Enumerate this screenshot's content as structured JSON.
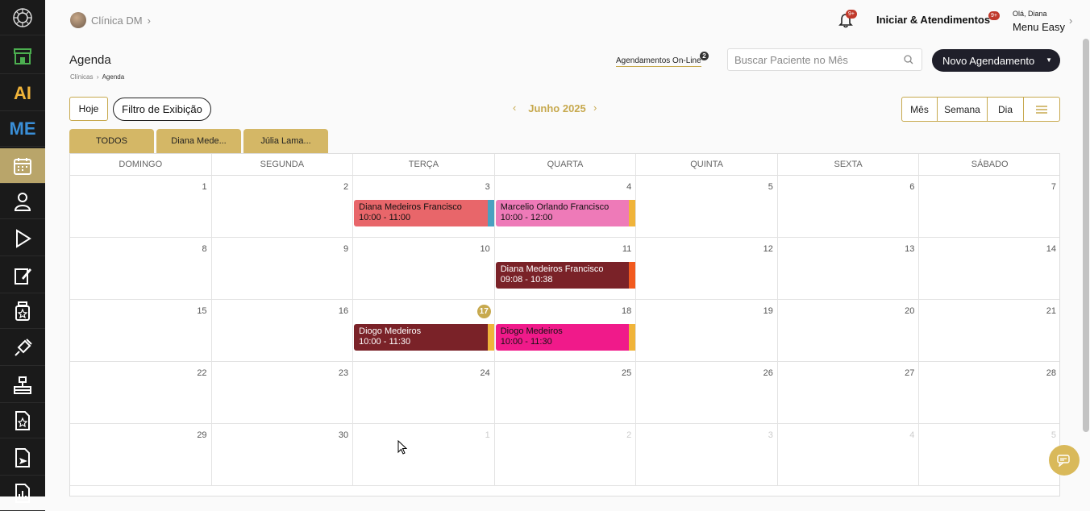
{
  "colors": {
    "accent": "#c7a94e",
    "tab_bg": "#d4b766",
    "sidebar": "#1a1a1a",
    "primary_button": "#1f1f2a"
  },
  "sidebar": {
    "items": [
      {
        "icon": "logo-icon"
      },
      {
        "icon": "store-icon"
      },
      {
        "icon": "ai-icon",
        "text": "AI"
      },
      {
        "icon": "me-icon",
        "text": "ME"
      },
      {
        "icon": "calendar-icon"
      },
      {
        "icon": "doctor-icon"
      },
      {
        "icon": "play-icon"
      },
      {
        "icon": "edit-document-icon"
      },
      {
        "icon": "medicine-bottle-icon"
      },
      {
        "icon": "syringe-icon"
      },
      {
        "icon": "organization-icon"
      },
      {
        "icon": "star-document-icon"
      },
      {
        "icon": "send-document-icon"
      },
      {
        "icon": "chart-document-icon"
      }
    ]
  },
  "header": {
    "clinic": "Clínica DM",
    "notifications_badge": "9+",
    "iniciar_label": "Iniciar & Atendimentos",
    "iniciar_badge": "9+",
    "greeting": "Olá, Diana",
    "menu": "Menu Easy"
  },
  "page": {
    "title": "Agenda",
    "breadcrumb": [
      "Clínicas",
      "Agenda"
    ],
    "online_label": "Agendamentos On-Line",
    "online_count": "2",
    "search_placeholder": "Buscar Paciente no Mês",
    "new_button": "Novo Agendamento"
  },
  "toolbar": {
    "today": "Hoje",
    "filter": "Filtro de Exibição",
    "month": "Junho 2025",
    "views": [
      "Mês",
      "Semana",
      "Dia"
    ]
  },
  "tabs": [
    "TODOS",
    "Diana Mede...",
    "Júlia Lama..."
  ],
  "calendar": {
    "weekdays": [
      "DOMINGO",
      "SEGUNDA",
      "TERÇA",
      "QUARTA",
      "QUINTA",
      "SEXTA",
      "SÁBADO"
    ],
    "weeks": [
      [
        "1",
        "2",
        "3",
        "4",
        "5",
        "6",
        "7"
      ],
      [
        "8",
        "9",
        "10",
        "11",
        "12",
        "13",
        "14"
      ],
      [
        "15",
        "16",
        "17",
        "18",
        "19",
        "20",
        "21"
      ],
      [
        "22",
        "23",
        "24",
        "25",
        "26",
        "27",
        "28"
      ],
      [
        "29",
        "30",
        "1",
        "2",
        "3",
        "4",
        "5"
      ]
    ],
    "today": "17",
    "events": [
      {
        "week": 0,
        "day": 2,
        "name": "Diana Medeiros Francisco",
        "time": "10:00 - 11:00",
        "color": "#e8666a",
        "strip": "#4aa0c0",
        "text": "#111"
      },
      {
        "week": 0,
        "day": 3,
        "name": "Marcelio Orlando Francisco",
        "time": "10:00 - 12:00",
        "color": "#ee7ab8",
        "strip": "#f0b43a",
        "text": "#111"
      },
      {
        "week": 1,
        "day": 3,
        "name": "Diana Medeiros Francisco",
        "time": "09:08 - 10:38",
        "color": "#7a2228",
        "strip": "#f25a1e",
        "text": "#fff"
      },
      {
        "week": 2,
        "day": 2,
        "name": "Diogo Medeiros",
        "time": "10:00 - 11:30",
        "color": "#7a2228",
        "strip": "#f0b43a",
        "text": "#fff"
      },
      {
        "week": 2,
        "day": 3,
        "name": "Diogo Medeiros",
        "time": "10:00 - 11:30",
        "color": "#f01a8a",
        "strip": "#f0b43a",
        "text": "#111"
      }
    ]
  }
}
